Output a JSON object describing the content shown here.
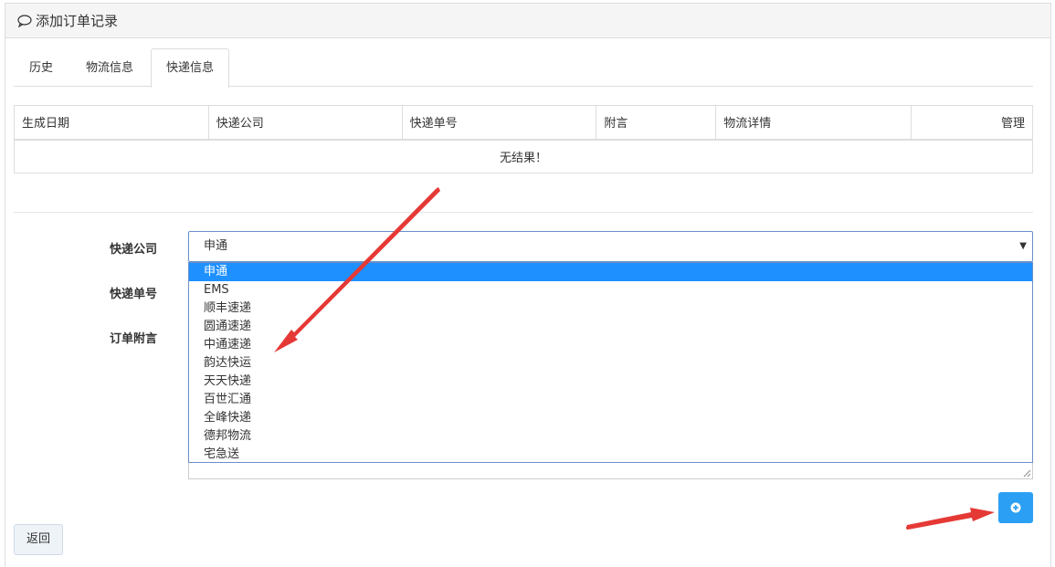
{
  "panel": {
    "title": "添加订单记录"
  },
  "tabs": [
    {
      "label": "历史"
    },
    {
      "label": "物流信息"
    },
    {
      "label": "快递信息"
    }
  ],
  "table": {
    "headers": [
      "生成日期",
      "快递公司",
      "快递单号",
      "附言",
      "物流详情",
      "管理"
    ],
    "empty_text": "无结果！"
  },
  "form": {
    "company_label": "快递公司",
    "tracking_label": "快递单号",
    "note_label": "订单附言",
    "company_selected": "申通",
    "company_options": [
      "申通",
      "EMS",
      "顺丰速递",
      "圆通速递",
      "中通速递",
      "韵达快运",
      "天天快递",
      "百世汇通",
      "全峰快递",
      "德邦物流",
      "宅急送"
    ]
  },
  "buttons": {
    "back_label": "返回"
  },
  "colors": {
    "accent": "#2b9ff4",
    "selected_option": "#1e90ff",
    "arrow": "#e53935"
  },
  "icons": {
    "heading": "chat-bubble-icon",
    "add": "plus-circle-icon",
    "select": "caret-down-icon"
  }
}
